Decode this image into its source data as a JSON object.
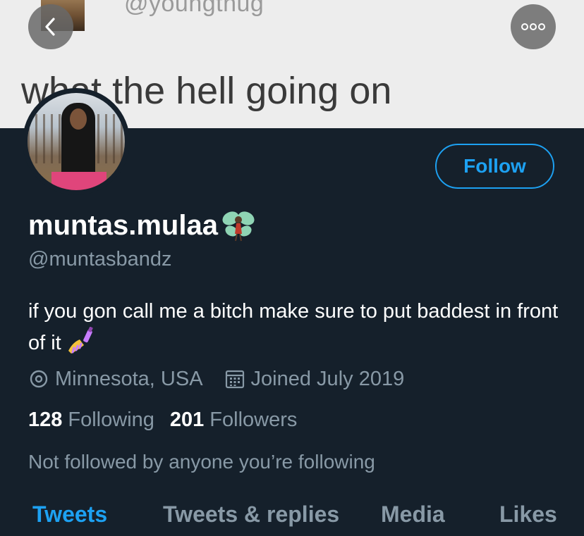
{
  "banner": {
    "handle_text": "@youngthug",
    "caption": "what the hell going on"
  },
  "nav": {
    "back_icon": "chevron-left-icon",
    "more_icon": "more-options-icon"
  },
  "profile": {
    "follow_label": "Follow",
    "display_name": "muntas.mulaa",
    "name_emoji": "fairy-emoji",
    "handle": "@muntasbandz",
    "bio": "if you gon call me a bitch make sure to put baddest in front of it",
    "bio_emoji": "nail-polish-emoji",
    "location": "Minnesota, USA",
    "joined": "Joined July 2019",
    "following_count": "128",
    "following_label": "Following",
    "followers_count": "201",
    "followers_label": "Followers",
    "not_followed_note": "Not followed by anyone you’re following"
  },
  "tabs": [
    {
      "label": "Tweets",
      "active": true
    },
    {
      "label": "Tweets & replies",
      "active": false
    },
    {
      "label": "Media",
      "active": false
    },
    {
      "label": "Likes",
      "active": false
    }
  ],
  "colors": {
    "background": "#15202b",
    "accent": "#1da1f2",
    "secondary_text": "#8899a6"
  }
}
